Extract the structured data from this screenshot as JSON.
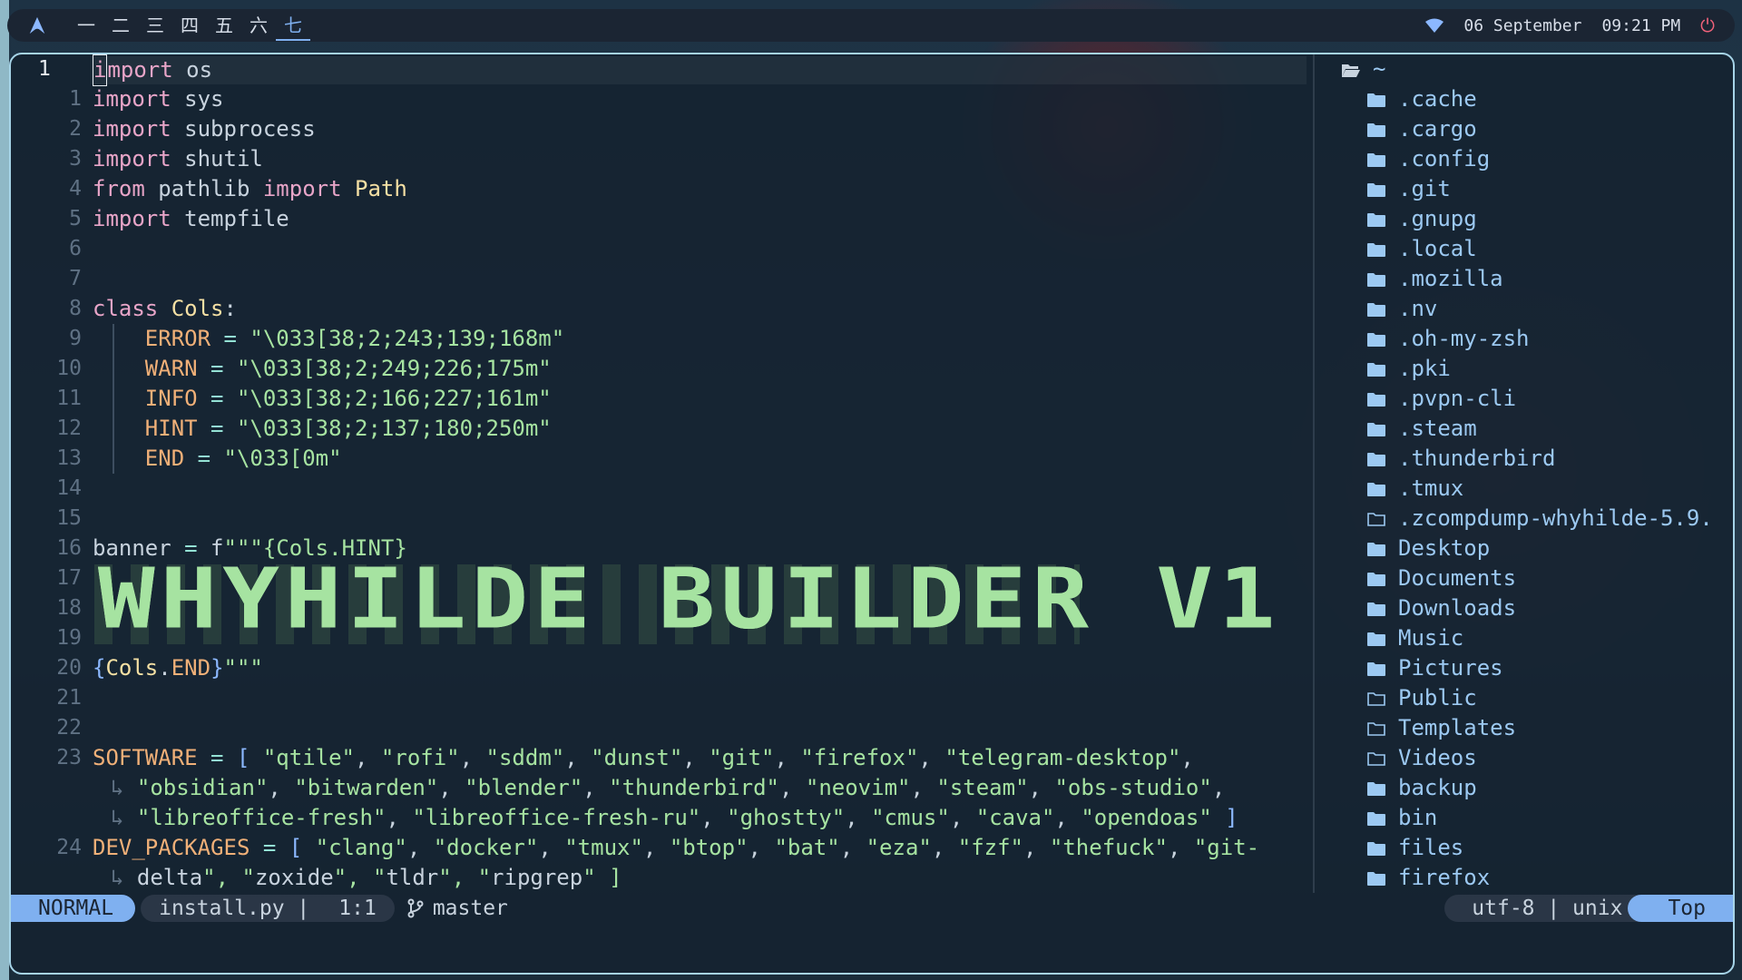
{
  "topbar": {
    "workspaces": [
      "一",
      "二",
      "三",
      "四",
      "五",
      "六",
      "七"
    ],
    "active_workspace": "七",
    "date": "06 September",
    "time": "09:21 PM"
  },
  "editor": {
    "lines": [
      {
        "num": "1",
        "current": true,
        "code": "import os"
      },
      {
        "num": "1",
        "code": "import sys"
      },
      {
        "num": "2",
        "code": "import subprocess"
      },
      {
        "num": "3",
        "code": "import shutil"
      },
      {
        "num": "4",
        "code": "from pathlib import Path"
      },
      {
        "num": "5",
        "code": "import tempfile"
      },
      {
        "num": "6",
        "code": ""
      },
      {
        "num": "7",
        "code": ""
      },
      {
        "num": "8",
        "code": "class Cols:"
      },
      {
        "num": "9",
        "code": "    ERROR = \"\\033[38;2;243;139;168m\""
      },
      {
        "num": "10",
        "code": "    WARN = \"\\033[38;2;249;226;175m\""
      },
      {
        "num": "11",
        "code": "    INFO = \"\\033[38;2;166;227;161m\""
      },
      {
        "num": "12",
        "code": "    HINT = \"\\033[38;2;137;180;250m\""
      },
      {
        "num": "13",
        "code": "    END = \"\\033[0m\""
      },
      {
        "num": "14",
        "code": ""
      },
      {
        "num": "15",
        "code": ""
      },
      {
        "num": "16",
        "code": "banner = f\"\"\"{Cols.HINT}"
      },
      {
        "num": "17",
        "code": ""
      },
      {
        "num": "18",
        "code": ""
      },
      {
        "num": "19",
        "code": ""
      },
      {
        "num": "20",
        "code": "{Cols.END}\"\"\""
      },
      {
        "num": "21",
        "code": ""
      },
      {
        "num": "22",
        "code": ""
      },
      {
        "num": "23",
        "code": "SOFTWARE = [ \"qtile\", \"rofi\", \"sddm\", \"dunst\", \"git\", \"firefox\", \"telegram-desktop\","
      },
      {
        "num": "",
        "wrap": true,
        "code": "\"obsidian\", \"bitwarden\", \"blender\", \"thunderbird\", \"neovim\", \"steam\", \"obs-studio\","
      },
      {
        "num": "",
        "wrap": true,
        "code": "\"libreoffice-fresh\", \"libreoffice-fresh-ru\", \"ghostty\", \"cmus\", \"cava\", \"opendoas\" ]"
      },
      {
        "num": "24",
        "code": "DEV_PACKAGES = [ \"clang\", \"docker\", \"tmux\", \"btop\", \"bat\", \"eza\", \"fzf\", \"thefuck\", \"git-"
      },
      {
        "num": "",
        "wrap": true,
        "code": "delta\", \"zoxide\", \"tldr\", \"ripgrep\" ]"
      }
    ],
    "banner_text": "WHYHILDE BUILDER V1"
  },
  "tree": {
    "root": "~",
    "items": [
      {
        "name": ".cache",
        "icon": "folder-filled"
      },
      {
        "name": ".cargo",
        "icon": "folder-filled"
      },
      {
        "name": ".config",
        "icon": "folder-filled"
      },
      {
        "name": ".git",
        "icon": "folder-filled"
      },
      {
        "name": ".gnupg",
        "icon": "folder-filled"
      },
      {
        "name": ".local",
        "icon": "folder-filled"
      },
      {
        "name": ".mozilla",
        "icon": "folder-filled"
      },
      {
        "name": ".nv",
        "icon": "folder-filled"
      },
      {
        "name": ".oh-my-zsh",
        "icon": "folder-filled"
      },
      {
        "name": ".pki",
        "icon": "folder-filled"
      },
      {
        "name": ".pvpn-cli",
        "icon": "folder-filled"
      },
      {
        "name": ".steam",
        "icon": "folder-filled"
      },
      {
        "name": ".thunderbird",
        "icon": "folder-filled"
      },
      {
        "name": ".tmux",
        "icon": "folder-filled"
      },
      {
        "name": ".zcompdump-whyhilde-5.9.",
        "icon": "folder-empty"
      },
      {
        "name": "Desktop",
        "icon": "folder-filled"
      },
      {
        "name": "Documents",
        "icon": "folder-filled"
      },
      {
        "name": "Downloads",
        "icon": "folder-filled"
      },
      {
        "name": "Music",
        "icon": "folder-filled"
      },
      {
        "name": "Pictures",
        "icon": "folder-filled"
      },
      {
        "name": "Public",
        "icon": "folder-empty"
      },
      {
        "name": "Templates",
        "icon": "folder-empty"
      },
      {
        "name": "Videos",
        "icon": "folder-empty"
      },
      {
        "name": "backup",
        "icon": "folder-filled"
      },
      {
        "name": "bin",
        "icon": "folder-filled"
      },
      {
        "name": "files",
        "icon": "folder-filled"
      },
      {
        "name": "firefox",
        "icon": "folder-filled"
      }
    ]
  },
  "statusline": {
    "mode": "NORMAL",
    "filename": "install.py |",
    "position": "1:1",
    "branch": "master",
    "encoding": "utf-8 | unix",
    "scroll": "Top"
  },
  "colors": {
    "accent": "#7fb0f0",
    "string": "#a6e3a1",
    "keyword": "#e8a5c8",
    "attr": "#f0b078",
    "power": "#f0627a"
  }
}
